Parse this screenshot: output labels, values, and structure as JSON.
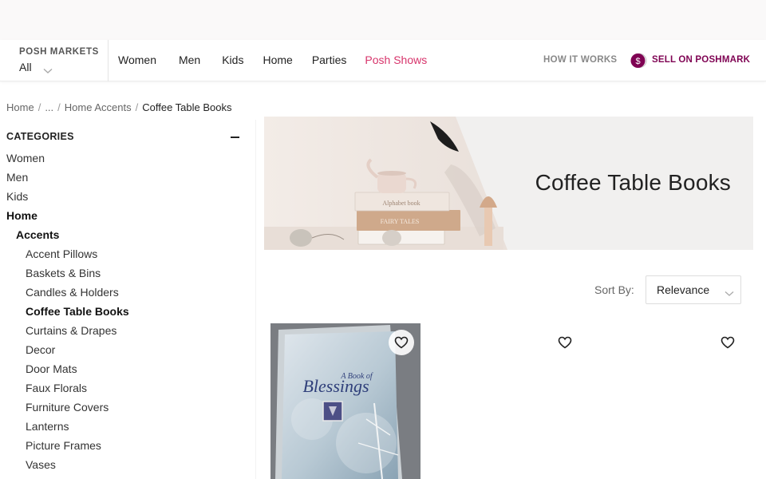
{
  "colors": {
    "accent_posh": "#d7346b",
    "sell_brand": "#7f0353",
    "text_dark": "#222222",
    "text_muted": "#666666"
  },
  "header": {
    "market_label": "POSH MARKETS",
    "market_value": "All",
    "nav": [
      {
        "label": "Women"
      },
      {
        "label": "Men"
      },
      {
        "label": "Kids"
      },
      {
        "label": "Home"
      },
      {
        "label": "Parties"
      },
      {
        "label": "Posh Shows"
      }
    ],
    "how_it_works": "HOW IT WORKS",
    "sell_label": "SELL ON POSHMARK",
    "sell_icon": "dollar-coin-icon"
  },
  "breadcrumb": {
    "items": [
      "Home",
      "...",
      "Home Accents"
    ],
    "current": "Coffee Table Books"
  },
  "sidebar": {
    "heading": "CATEGORIES",
    "collapse_icon": "minus-icon",
    "items": [
      {
        "label": "Women",
        "level": 0,
        "bold": false
      },
      {
        "label": "Men",
        "level": 0,
        "bold": false
      },
      {
        "label": "Kids",
        "level": 0,
        "bold": false
      },
      {
        "label": "Home",
        "level": 0,
        "bold": true
      },
      {
        "label": "Accents",
        "level": 1,
        "bold": true
      },
      {
        "label": "Accent Pillows",
        "level": 2,
        "bold": false
      },
      {
        "label": "Baskets & Bins",
        "level": 2,
        "bold": false
      },
      {
        "label": "Candles & Holders",
        "level": 2,
        "bold": false
      },
      {
        "label": "Coffee Table Books",
        "level": 2,
        "bold": true
      },
      {
        "label": "Curtains & Drapes",
        "level": 2,
        "bold": false
      },
      {
        "label": "Decor",
        "level": 2,
        "bold": false
      },
      {
        "label": "Door Mats",
        "level": 2,
        "bold": false
      },
      {
        "label": "Faux Florals",
        "level": 2,
        "bold": false
      },
      {
        "label": "Furniture Covers",
        "level": 2,
        "bold": false
      },
      {
        "label": "Lanterns",
        "level": 2,
        "bold": false
      },
      {
        "label": "Picture Frames",
        "level": 2,
        "bold": false
      },
      {
        "label": "Vases",
        "level": 2,
        "bold": false
      }
    ]
  },
  "hero": {
    "title": "Coffee Table Books",
    "book_labels": [
      "Alphabet book",
      "FAIRY TALES"
    ]
  },
  "sort": {
    "label": "Sort By:",
    "value": "Relevance"
  },
  "products": [
    {
      "cover_text_1": "A Book of",
      "cover_text_2": "Blessings",
      "like_icon": "heart-icon"
    },
    {
      "like_icon": "heart-icon"
    },
    {
      "like_icon": "heart-icon"
    }
  ]
}
